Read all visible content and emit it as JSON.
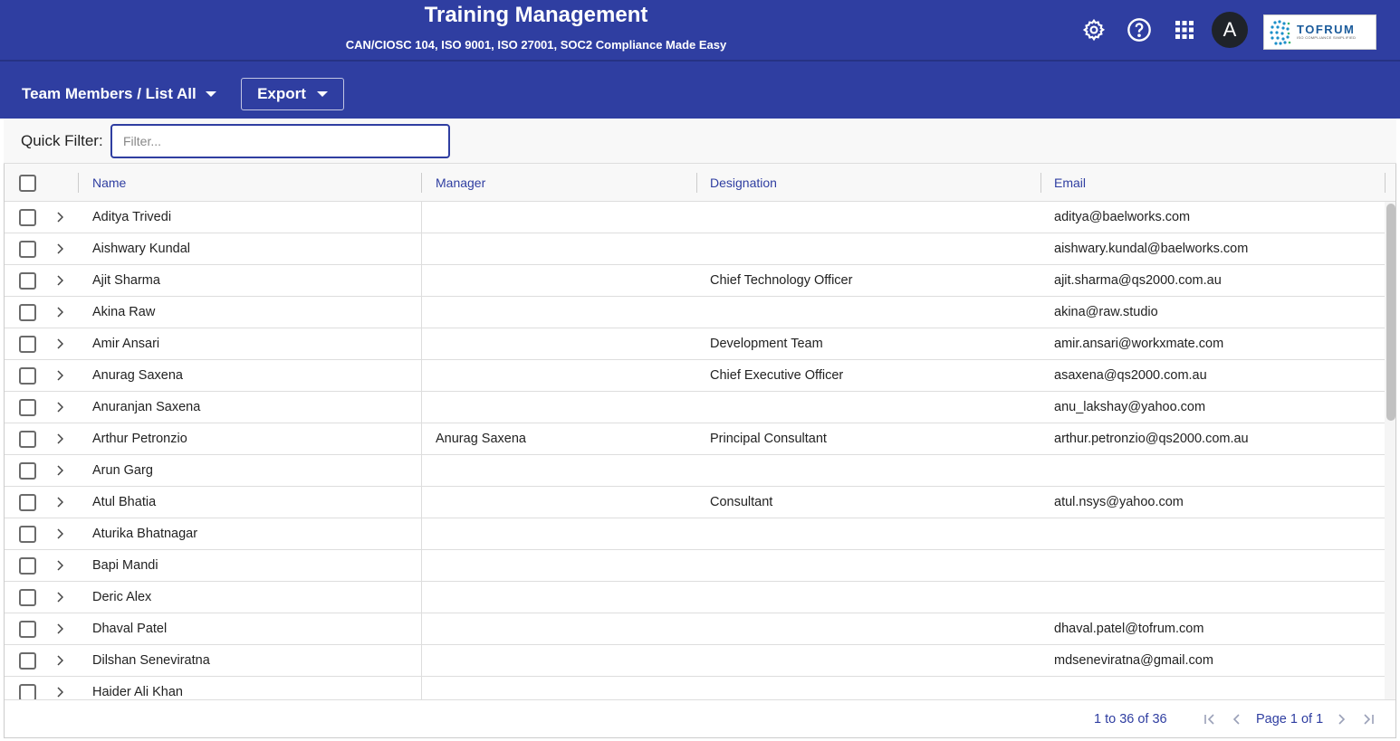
{
  "header": {
    "title": "Training Management",
    "subtitle": "CAN/CIOSC 104, ISO 9001, ISO 27001, SOC2 Compliance Made Easy",
    "icons": [
      "gear-icon",
      "help-icon",
      "apps-grid-icon"
    ],
    "avatar_letter": "A",
    "logo": {
      "name": "TOFRUM",
      "tagline": "ISO COMPLIANCE SIMPLIFIED"
    }
  },
  "toolbar": {
    "breadcrumb": "Team Members / List All",
    "export_label": "Export"
  },
  "filter": {
    "label": "Quick Filter:",
    "placeholder": "Filter...",
    "value": ""
  },
  "grid": {
    "columns": [
      "Name",
      "Manager",
      "Designation",
      "Email"
    ],
    "rows": [
      {
        "name": "Aditya Trivedi",
        "manager": "",
        "designation": "",
        "email": "aditya@baelworks.com"
      },
      {
        "name": "Aishwary Kundal",
        "manager": "",
        "designation": "",
        "email": "aishwary.kundal@baelworks.com"
      },
      {
        "name": "Ajit Sharma",
        "manager": "",
        "designation": "Chief Technology Officer",
        "email": "ajit.sharma@qs2000.com.au"
      },
      {
        "name": "Akina Raw",
        "manager": "",
        "designation": "",
        "email": "akina@raw.studio"
      },
      {
        "name": "Amir Ansari",
        "manager": "",
        "designation": "Development Team",
        "email": "amir.ansari@workxmate.com"
      },
      {
        "name": "Anurag Saxena",
        "manager": "",
        "designation": "Chief Executive Officer",
        "email": "asaxena@qs2000.com.au"
      },
      {
        "name": "Anuranjan Saxena",
        "manager": "",
        "designation": "",
        "email": "anu_lakshay@yahoo.com"
      },
      {
        "name": "Arthur Petronzio",
        "manager": "Anurag Saxena",
        "designation": "Principal Consultant",
        "email": "arthur.petronzio@qs2000.com.au"
      },
      {
        "name": "Arun Garg",
        "manager": "",
        "designation": "",
        "email": ""
      },
      {
        "name": "Atul Bhatia",
        "manager": "",
        "designation": "Consultant",
        "email": "atul.nsys@yahoo.com"
      },
      {
        "name": "Aturika Bhatnagar",
        "manager": "",
        "designation": "",
        "email": ""
      },
      {
        "name": "Bapi Mandi",
        "manager": "",
        "designation": "",
        "email": ""
      },
      {
        "name": "Deric Alex",
        "manager": "",
        "designation": "",
        "email": ""
      },
      {
        "name": "Dhaval Patel",
        "manager": "",
        "designation": "",
        "email": "dhaval.patel@tofrum.com"
      },
      {
        "name": "Dilshan Seneviratna",
        "manager": "",
        "designation": "",
        "email": "mdseneviratna@gmail.com"
      },
      {
        "name": "Haider Ali Khan",
        "manager": "",
        "designation": "",
        "email": ""
      }
    ]
  },
  "pagination": {
    "summary": "1 to 36 of 36",
    "page_label": "Page 1 of 1"
  },
  "colors": {
    "primary": "#2f3ea1",
    "avatar_bg": "#1f2329"
  }
}
